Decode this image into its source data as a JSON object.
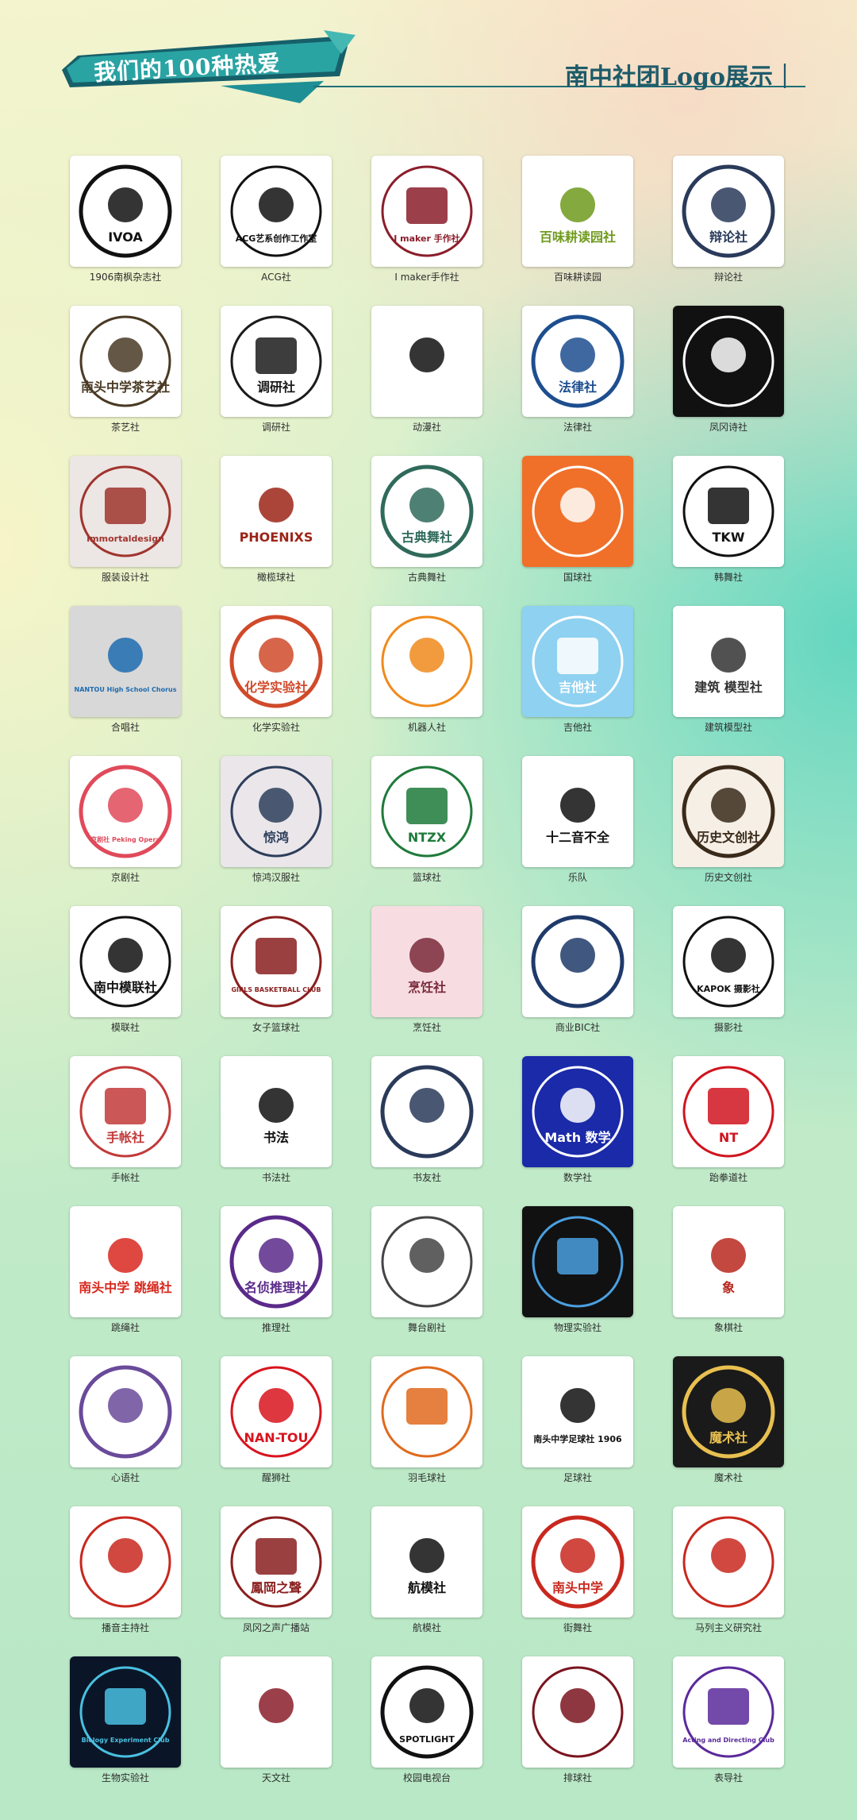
{
  "header": {
    "banner_title": "我们的100种热爱",
    "subtitle": "南中社团Logo展示｜"
  },
  "colors": {
    "banner_teal": "#1f8f96",
    "banner_dark": "#16606a",
    "rule": "#1f6f78"
  },
  "clubs": [
    {
      "name": "1906南枫杂志社",
      "logo_text": "IVOA",
      "icon": "ivoa-logo-icon",
      "bg": "#ffffff",
      "fg": "#111111"
    },
    {
      "name": "ACG社",
      "logo_text": "ACG艺系创作工作室",
      "icon": "acg-swirl-icon",
      "bg": "#ffffff",
      "fg": "#111111"
    },
    {
      "name": "I maker手作社",
      "logo_text": "I maker 手作社",
      "icon": "yarn-ball-icon",
      "bg": "#ffffff",
      "fg": "#8a1e2b"
    },
    {
      "name": "百味耕读园",
      "logo_text": "百味耕读园社",
      "icon": "sprout-icon",
      "bg": "#ffffff",
      "fg": "#6f9a1c"
    },
    {
      "name": "辩论社",
      "logo_text": "辩论社",
      "icon": "debate-badge-icon",
      "bg": "#ffffff",
      "fg": "#2a3a5a"
    },
    {
      "name": "茶艺社",
      "logo_text": "南头中学茶艺社",
      "icon": "tea-cup-icon",
      "bg": "#ffffff",
      "fg": "#4a3a24"
    },
    {
      "name": "调研社",
      "logo_text": "调研社",
      "icon": "octopus-icon",
      "bg": "#ffffff",
      "fg": "#1b1b1b"
    },
    {
      "name": "动漫社",
      "logo_text": "",
      "icon": "anime-face-icon",
      "bg": "#ffffff",
      "fg": "#111111"
    },
    {
      "name": "法律社",
      "logo_text": "法律社",
      "icon": "scales-icon",
      "bg": "#ffffff",
      "fg": "#1d4e8f"
    },
    {
      "name": "凤冈诗社",
      "logo_text": "",
      "icon": "poetry-book-icon",
      "bg": "#111111",
      "fg": "#ffffff"
    },
    {
      "name": "服装设计社",
      "logo_text": "Immortaldesign",
      "icon": "fashion-script-icon",
      "bg": "#ece6e4",
      "fg": "#a0342e"
    },
    {
      "name": "橄榄球社",
      "logo_text": "PHOENIXS",
      "icon": "phoenix-icon",
      "bg": "#ffffff",
      "fg": "#9c2418"
    },
    {
      "name": "古典舞社",
      "logo_text": "古典舞社",
      "icon": "classical-dance-icon",
      "bg": "#ffffff",
      "fg": "#2f6a5a"
    },
    {
      "name": "国球社",
      "logo_text": "",
      "icon": "ping-pong-icon",
      "bg": "#f0702a",
      "fg": "#ffffff"
    },
    {
      "name": "韩舞社",
      "logo_text": "TKW",
      "icon": "tkw-splash-icon",
      "bg": "#ffffff",
      "fg": "#111111"
    },
    {
      "name": "合唱社",
      "logo_text": "NANTOU High School Chorus",
      "icon": "treble-clef-icon",
      "bg": "#d8d8d8",
      "fg": "#1e6cb0"
    },
    {
      "name": "化学实验社",
      "logo_text": "化学实验社",
      "icon": "atom-icon",
      "bg": "#ffffff",
      "fg": "#d04a2a"
    },
    {
      "name": "机器人社",
      "logo_text": "",
      "icon": "robot-head-icon",
      "bg": "#ffffff",
      "fg": "#f08a1c"
    },
    {
      "name": "吉他社",
      "logo_text": "吉他社",
      "icon": "guitar-icon",
      "bg": "#8fd1f0",
      "fg": "#ffffff"
    },
    {
      "name": "建筑模型社",
      "logo_text": "建筑 模型社",
      "icon": "architecture-icon",
      "bg": "#ffffff",
      "fg": "#333333"
    },
    {
      "name": "京剧社",
      "logo_text": "京剧社 Peking Opera",
      "icon": "opera-mask-icon",
      "bg": "#ffffff",
      "fg": "#e04a5a"
    },
    {
      "name": "惊鸿汉服社",
      "logo_text": "惊鸿",
      "icon": "hanfu-lady-icon",
      "bg": "#eae6ea",
      "fg": "#2d3e5a"
    },
    {
      "name": "篮球社",
      "logo_text": "NTZX",
      "icon": "basketball-shield-icon",
      "bg": "#ffffff",
      "fg": "#1f7a3a"
    },
    {
      "name": "乐队",
      "logo_text": "十二音不全",
      "icon": "music-note-cat-icon",
      "bg": "#ffffff",
      "fg": "#111111"
    },
    {
      "name": "历史文创社",
      "logo_text": "历史文创社",
      "icon": "history-building-icon",
      "bg": "#f6efe6",
      "fg": "#3a2a1a"
    },
    {
      "name": "模联社",
      "logo_text": "南中模联社",
      "icon": "mun-globe-icon",
      "bg": "#ffffff",
      "fg": "#111111"
    },
    {
      "name": "女子篮球社",
      "logo_text": "GIRLS BASKETBALL CLUB",
      "icon": "girls-basketball-icon",
      "bg": "#ffffff",
      "fg": "#8a1e1e"
    },
    {
      "name": "烹饪社",
      "logo_text": "烹饪社",
      "icon": "cake-icon",
      "bg": "#f7dde2",
      "fg": "#7a2a3a"
    },
    {
      "name": "商业BIC社",
      "logo_text": "",
      "icon": "business-chart-icon",
      "bg": "#ffffff",
      "fg": "#1f3a6a"
    },
    {
      "name": "摄影社",
      "logo_text": "KAPOK 摄影社",
      "icon": "camera-icon",
      "bg": "#ffffff",
      "fg": "#111111"
    },
    {
      "name": "手帐社",
      "logo_text": "手帐社",
      "icon": "planner-icon",
      "bg": "#ffffff",
      "fg": "#c23a3a"
    },
    {
      "name": "书法社",
      "logo_text": "书法",
      "icon": "calligraphy-brush-icon",
      "bg": "#ffffff",
      "fg": "#111111"
    },
    {
      "name": "书友社",
      "logo_text": "",
      "icon": "open-book-icon",
      "bg": "#ffffff",
      "fg": "#2a3a5a"
    },
    {
      "name": "数学社",
      "logo_text": "Math 数学",
      "icon": "math-burst-icon",
      "bg": "#1a2aa8",
      "fg": "#ffffff"
    },
    {
      "name": "跆拳道社",
      "logo_text": "NT",
      "icon": "taekwondo-kick-icon",
      "bg": "#ffffff",
      "fg": "#d0141e"
    },
    {
      "name": "跳绳社",
      "logo_text": "南头中学 跳绳社",
      "icon": "jump-rope-icon",
      "bg": "#ffffff",
      "fg": "#d8281e"
    },
    {
      "name": "推理社",
      "logo_text": "名侦推理社",
      "icon": "detective-icon",
      "bg": "#ffffff",
      "fg": "#5a2a8a"
    },
    {
      "name": "舞台剧社",
      "logo_text": "",
      "icon": "stage-sketch-icon",
      "bg": "#ffffff",
      "fg": "#444444"
    },
    {
      "name": "物理实验社",
      "logo_text": "",
      "icon": "telescope-icon",
      "bg": "#111111",
      "fg": "#4aa0e0"
    },
    {
      "name": "象棋社",
      "logo_text": "象",
      "icon": "chess-piece-icon",
      "bg": "#ffffff",
      "fg": "#b8281e"
    },
    {
      "name": "心语社",
      "logo_text": "",
      "icon": "lavender-icon",
      "bg": "#ffffff",
      "fg": "#6a4a9a"
    },
    {
      "name": "醒狮社",
      "logo_text": "NAN-TOU",
      "icon": "lion-dance-icon",
      "bg": "#ffffff",
      "fg": "#d8141e"
    },
    {
      "name": "羽毛球社",
      "logo_text": "",
      "icon": "badminton-icon",
      "bg": "#ffffff",
      "fg": "#e06a1e"
    },
    {
      "name": "足球社",
      "logo_text": "南头中学足球社 1906",
      "icon": "soccer-ball-icon",
      "bg": "#ffffff",
      "fg": "#111111"
    },
    {
      "name": "魔术社",
      "logo_text": "魔术社",
      "icon": "magic-hat-icon",
      "bg": "#1a1a1a",
      "fg": "#e8c050"
    },
    {
      "name": "播音主持社",
      "logo_text": "",
      "icon": "broadcast-phoenix-icon",
      "bg": "#ffffff",
      "fg": "#c8281e"
    },
    {
      "name": "凤冈之声广播站",
      "logo_text": "鳳岡之聲",
      "icon": "radio-girl-icon",
      "bg": "#ffffff",
      "fg": "#8a1e1e"
    },
    {
      "name": "航模社",
      "logo_text": "航模社",
      "icon": "mecha-icon",
      "bg": "#ffffff",
      "fg": "#111111"
    },
    {
      "name": "街舞社",
      "logo_text": "南头中学",
      "icon": "street-dance-tree-icon",
      "bg": "#ffffff",
      "fg": "#c8281e"
    },
    {
      "name": "马列主义研究社",
      "logo_text": "",
      "icon": "marxism-shield-icon",
      "bg": "#ffffff",
      "fg": "#c8281e"
    },
    {
      "name": "生物实验社",
      "logo_text": "Biology Experiment Club",
      "icon": "microscope-dna-icon",
      "bg": "#0a1628",
      "fg": "#4ac0e0"
    },
    {
      "name": "天文社",
      "logo_text": "",
      "icon": "astronomy-swirl-icon",
      "bg": "#ffffff",
      "fg": "#8a1e2a"
    },
    {
      "name": "校园电视台",
      "logo_text": "SPOTLIGHT",
      "icon": "spotlight-icon",
      "bg": "#ffffff",
      "fg": "#111111"
    },
    {
      "name": "排球社",
      "logo_text": "",
      "icon": "volleyball-icon",
      "bg": "#ffffff",
      "fg": "#7a141e"
    },
    {
      "name": "表导社",
      "logo_text": "Acting and Directing Club",
      "icon": "drama-mask-icon",
      "bg": "#ffffff",
      "fg": "#5a2a9a"
    }
  ]
}
